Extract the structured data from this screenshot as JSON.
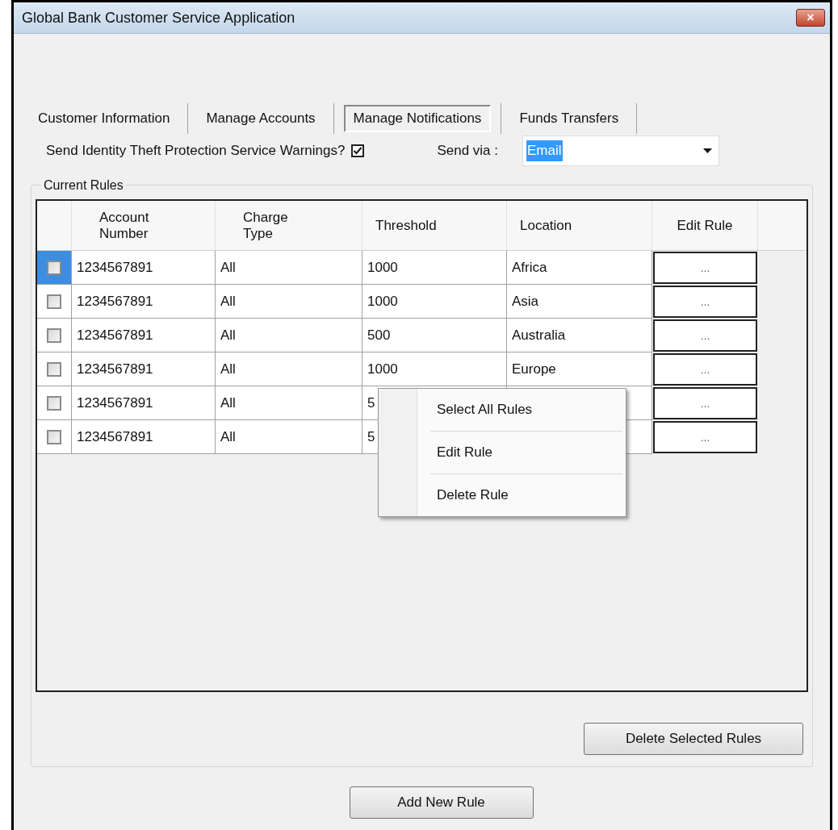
{
  "window": {
    "title": "Global Bank Customer Service Application",
    "close": "×"
  },
  "tabs": [
    {
      "label": "Customer Information",
      "selected": false
    },
    {
      "label": "Manage Accounts",
      "selected": false
    },
    {
      "label": "Manage Notifications",
      "selected": true
    },
    {
      "label": "Funds Transfers",
      "selected": false
    }
  ],
  "warnings": {
    "label": "Send Identity Theft Protection Service Warnings?",
    "checked": true
  },
  "send_via": {
    "label": "Send via :",
    "value": "Email"
  },
  "rules_group": {
    "title": "Current Rules"
  },
  "table": {
    "columns": [
      "Account Number",
      "Charge Type",
      "Threshold",
      "Location",
      "Edit Rule"
    ],
    "rows": [
      {
        "checked": false,
        "selected": true,
        "account": "1234567891",
        "charge_type": "All",
        "threshold": "1000",
        "location": "Africa",
        "edit": "..."
      },
      {
        "checked": false,
        "selected": false,
        "account": "1234567891",
        "charge_type": "All",
        "threshold": "1000",
        "location": "Asia",
        "edit": "..."
      },
      {
        "checked": false,
        "selected": false,
        "account": "1234567891",
        "charge_type": "All",
        "threshold": "500",
        "location": "Australia",
        "edit": "..."
      },
      {
        "checked": false,
        "selected": false,
        "account": "1234567891",
        "charge_type": "All",
        "threshold": "1000",
        "location": "Europe",
        "edit": "..."
      },
      {
        "checked": false,
        "selected": false,
        "account": "1234567891",
        "charge_type": "All",
        "threshold": "5",
        "edit": "..."
      },
      {
        "checked": false,
        "selected": false,
        "account": "1234567891",
        "charge_type": "All",
        "threshold": "5",
        "edit": "..."
      }
    ]
  },
  "context_menu": {
    "items": [
      "Select All Rules",
      "Edit Rule",
      "Delete Rule"
    ]
  },
  "buttons": {
    "delete_selected": "Delete Selected Rules",
    "add_new": "Add New Rule"
  }
}
